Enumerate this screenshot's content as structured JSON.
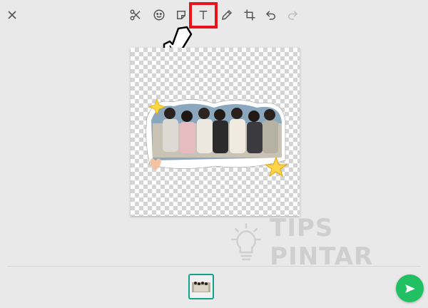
{
  "toolbar": {
    "icons": [
      "close-icon",
      "scissors-icon",
      "emoji-icon",
      "sticker-icon",
      "text-icon",
      "pencil-icon",
      "crop-rotate-icon",
      "undo-icon",
      "redo-icon"
    ],
    "highlighted_tool": "text-icon"
  },
  "canvas": {
    "background": "transparency-checkerboard",
    "sticker": "group-photo-cutout"
  },
  "watermark": {
    "text": "TIPS PINTAR"
  },
  "bottom": {
    "send_icon": "send-icon"
  },
  "colors": {
    "highlight": "#e8141b",
    "accent": "#21c063",
    "thumb_border": "#11a389",
    "icon": "#555555",
    "background": "#e9e9e9"
  }
}
